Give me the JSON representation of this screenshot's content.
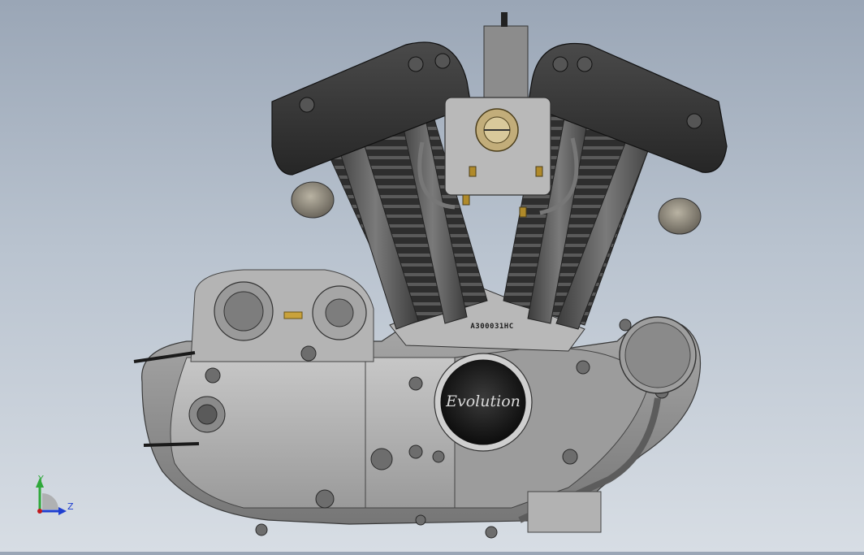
{
  "viewport": {
    "background_top": "#9aa6b6",
    "background_bottom": "#d7dde4",
    "model": {
      "engine_number_stamp": "A300031HC",
      "timer_cover_script": "Evolution",
      "rocker_box_color": "#3a3a3a",
      "casing_color": "#8e8e8e"
    }
  },
  "triad": {
    "y_label": "Y",
    "z_label": "Z",
    "y_color": "#2fa83a",
    "z_color": "#1f3fd0",
    "x_color": "#c0191e"
  }
}
